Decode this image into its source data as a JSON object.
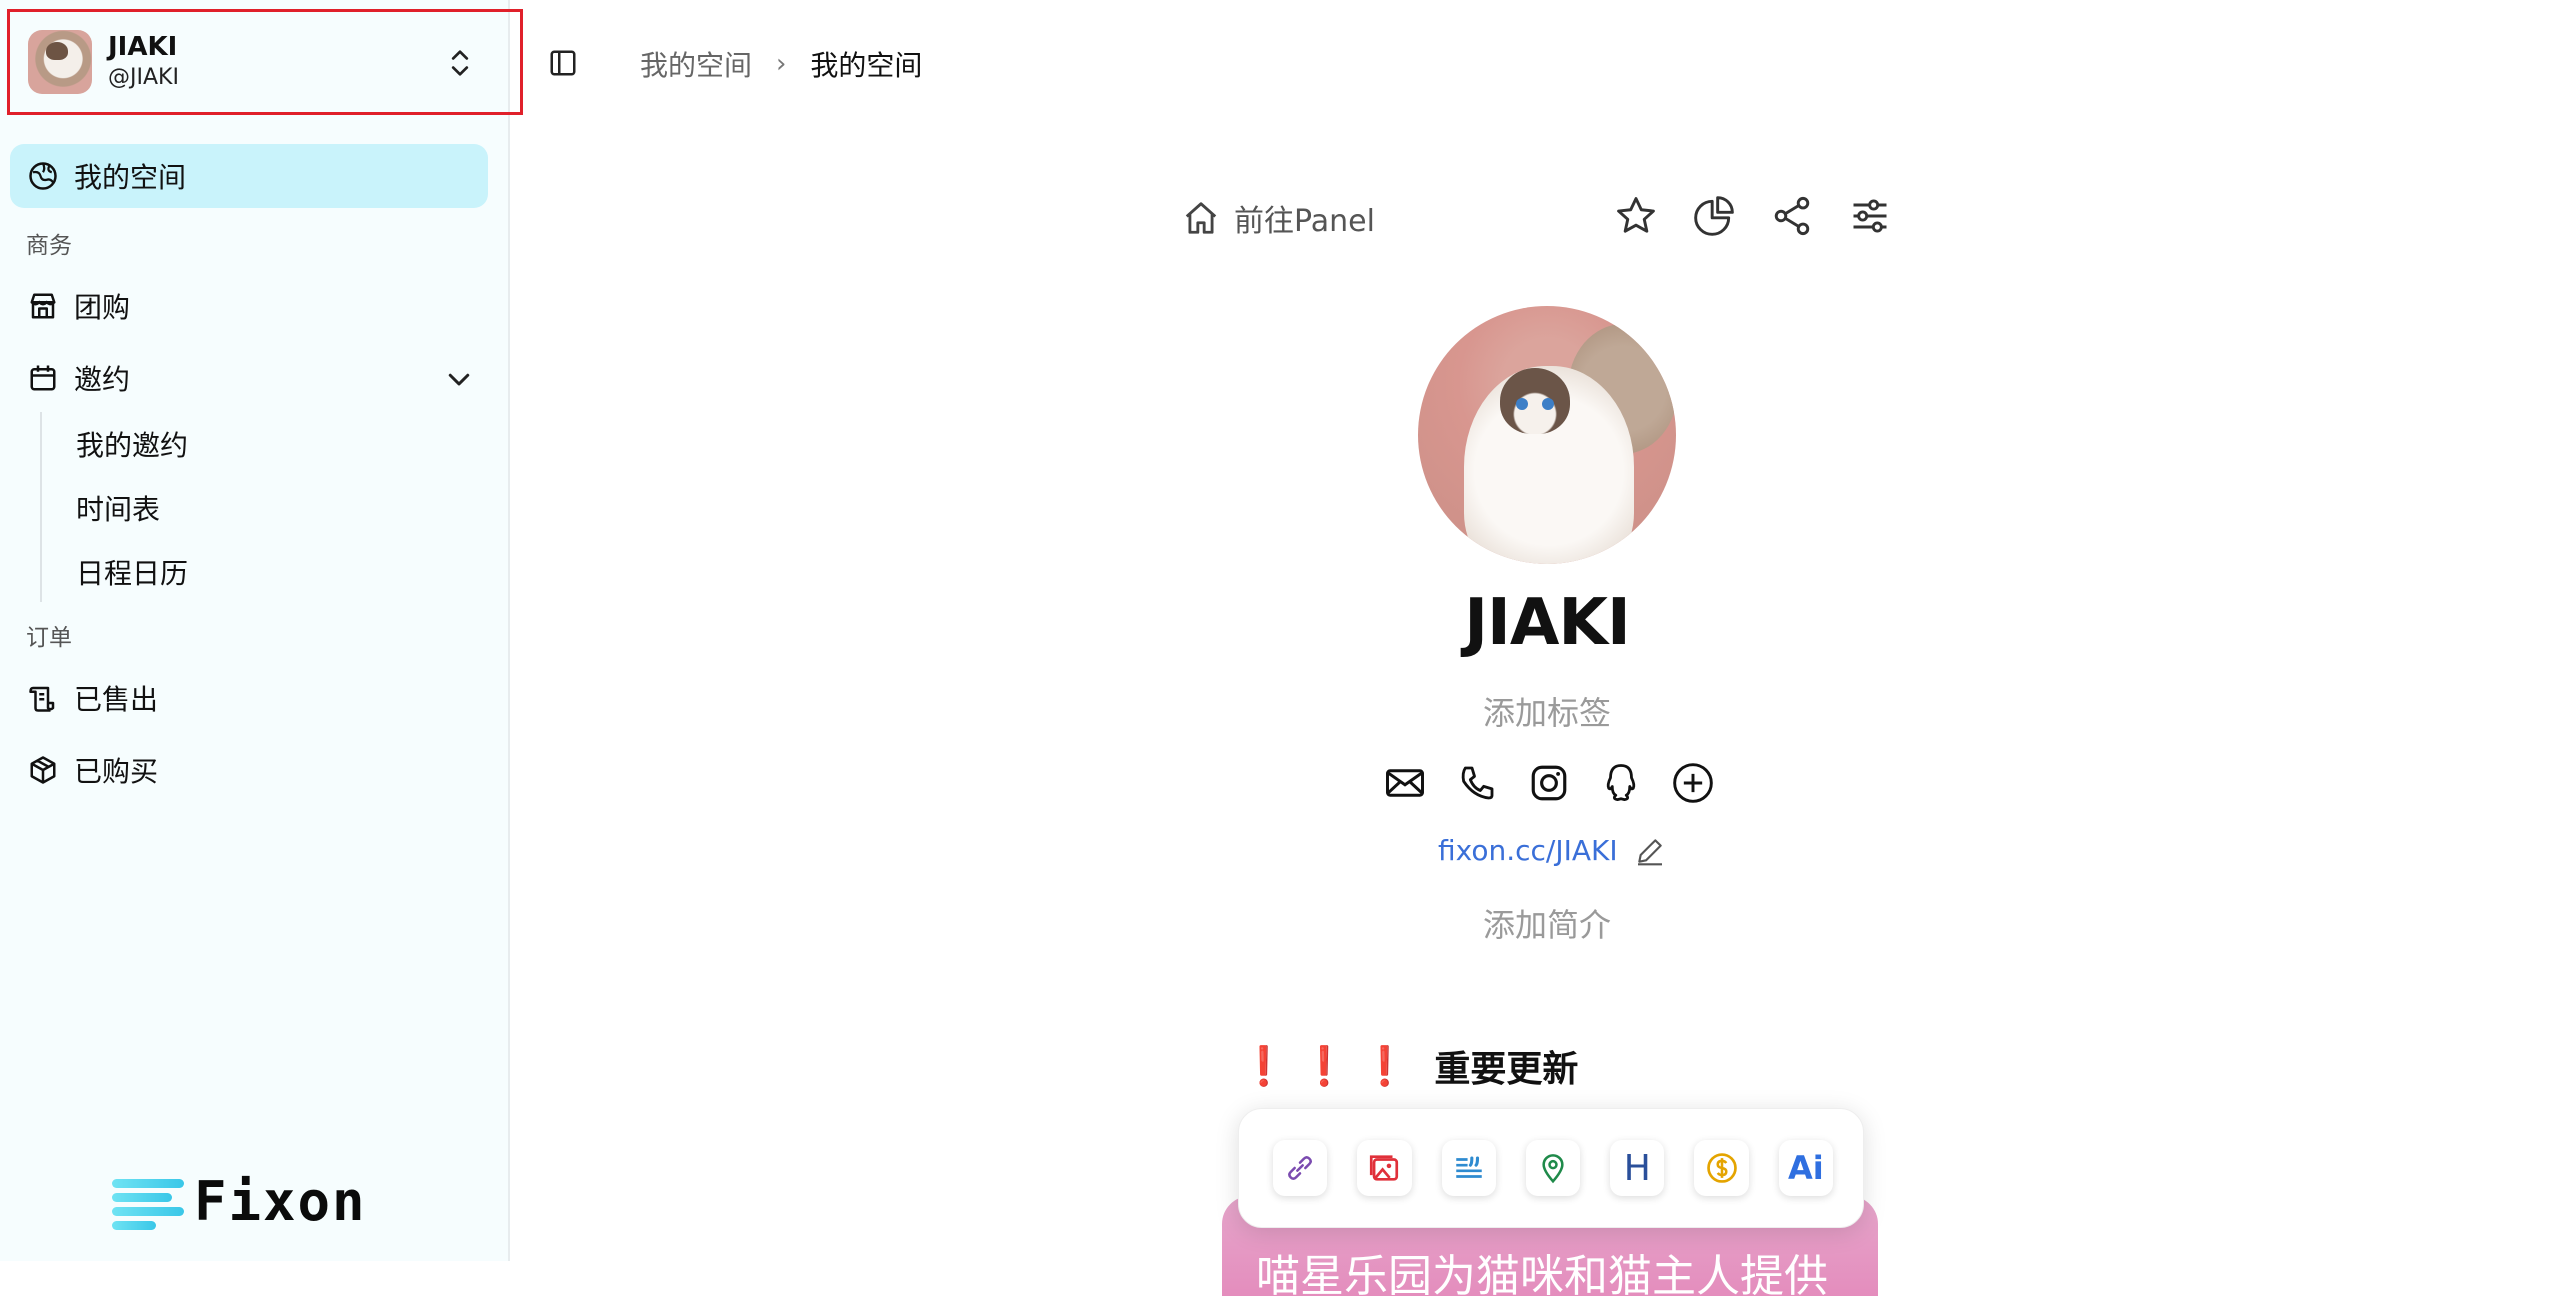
{
  "account": {
    "name": "JIAKI",
    "handle": "@JIAKI"
  },
  "sidebar": {
    "my_space": "我的空间",
    "section_business": "商务",
    "group_buy": "团购",
    "invitations": "邀约",
    "invitation_children": [
      "我的邀约",
      "时间表",
      "日程日历"
    ],
    "section_orders": "订单",
    "sold": "已售出",
    "purchased": "已购买"
  },
  "logo": {
    "text": "Fixon"
  },
  "breadcrumb": {
    "first": "我的空间",
    "current": "我的空间"
  },
  "main": {
    "goto_panel": "前往Panel",
    "profile_name": "JIAKI",
    "add_tag": "添加标签",
    "profile_link": "fixon.cc/JIAKI",
    "add_intro": "添加简介",
    "update_title": "重要更新",
    "update_marks": "❗ ❗ ❗",
    "banner_text": "喵星乐园为猫咪和猫主人提供"
  },
  "icons": {
    "tools": [
      "star-icon",
      "pie-chart-icon",
      "share-icon",
      "sliders-icon"
    ],
    "socials": [
      "mail-icon",
      "phone-icon",
      "instagram-icon",
      "qq-icon",
      "add-circle-icon"
    ],
    "blocks": [
      "link-icon",
      "image-icon",
      "text-icon",
      "map-pin-icon",
      "heading-icon",
      "dollar-icon",
      "ai-icon"
    ]
  },
  "colors": {
    "active_nav": "#c9f3fb",
    "link": "#3a6fd8",
    "alert": "#ff2d55",
    "highlight_border": "#e0202a",
    "banner": "#e48dbd"
  }
}
